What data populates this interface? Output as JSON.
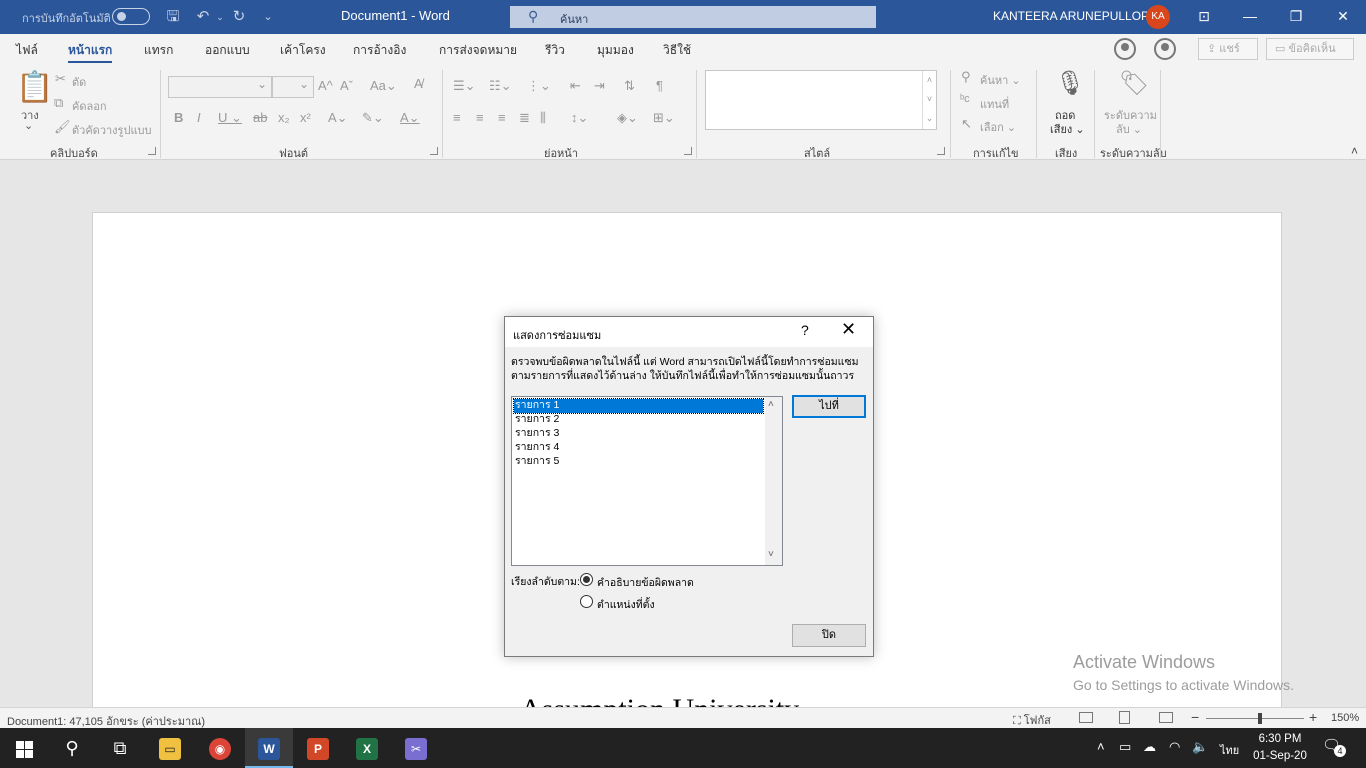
{
  "titlebar": {
    "autosave_label": "การบันทึกอัตโนมัติ",
    "doc_title": "Document1  -  Word",
    "search_placeholder": "ค้นหา",
    "username": "KANTEERA ARUNEPULLOP",
    "avatar_initials": "KA"
  },
  "tabs": [
    {
      "label": "ไฟล์"
    },
    {
      "label": "หน้าแรก"
    },
    {
      "label": "แทรก"
    },
    {
      "label": "ออกแบบ"
    },
    {
      "label": "เค้าโครง"
    },
    {
      "label": "การอ้างอิง"
    },
    {
      "label": "การส่งจดหมาย"
    },
    {
      "label": "รีวิว"
    },
    {
      "label": "มุมมอง"
    },
    {
      "label": "วิธีใช้"
    }
  ],
  "ribbon_right": {
    "share_label": "แชร์",
    "comments_label": "ข้อคิดเห็น"
  },
  "ribbon": {
    "clipboard": {
      "paste": "วาง",
      "cut": "ตัด",
      "copy": "คัดลอก",
      "format_painter": "ตัวคัดวางรูปแบบ",
      "label": "คลิปบอร์ด"
    },
    "font": {
      "label": "ฟอนต์"
    },
    "paragraph": {
      "label": "ย่อหน้า"
    },
    "styles": {
      "label": "สไตล์"
    },
    "editing": {
      "find": "ค้นหา",
      "replace": "แทนที่",
      "select": "เลือก",
      "label": "การแก้ไข"
    },
    "voice": {
      "dictate_1": "ถอด",
      "dictate_2": "เสียง",
      "label": "เสียง"
    },
    "sensitivity": {
      "btn_1": "ระดับความ",
      "btn_2": "ลับ",
      "label": "ระดับความลับ"
    }
  },
  "document": {
    "visible_text": "Assumption University"
  },
  "watermark": {
    "line1": "Activate Windows",
    "line2": "Go to Settings to activate Windows."
  },
  "dialog": {
    "title": "แสดงการซ่อมแซม",
    "help": "?",
    "message": "ตรวจพบข้อผิดพลาดในไฟล์นี้ แต่ Word สามารถเปิดไฟล์นี้โดยทำการซ่อมแซมตามรายการที่แสดงไว้ด้านล่าง ให้บันทึกไฟล์นี้เพื่อทำให้การซ่อมแซมนั้นถาวร",
    "items": [
      "รายการ 1",
      "รายการ 2",
      "รายการ 3",
      "รายการ 4",
      "รายการ 5"
    ],
    "goto_button": "ไปที่",
    "sort_label": "เรียงลำดับตาม:",
    "sort_options": [
      "คำอธิบายข้อผิดพลาด",
      "ตำแหน่งที่ตั้ง"
    ],
    "close_button": "ปิด"
  },
  "statusbar": {
    "word_count": "Document1: 47,105 อักขระ (ค่าประมาณ)",
    "focus": "โฟกัส",
    "zoom": "150%"
  },
  "taskbar": {
    "lang": "ไทย",
    "time": "6:30 PM",
    "date": "01-Sep-20",
    "notifications": "4"
  },
  "colors": {
    "word_blue": "#2b579a",
    "selection": "#0078d7",
    "taskbar": "#222222"
  }
}
